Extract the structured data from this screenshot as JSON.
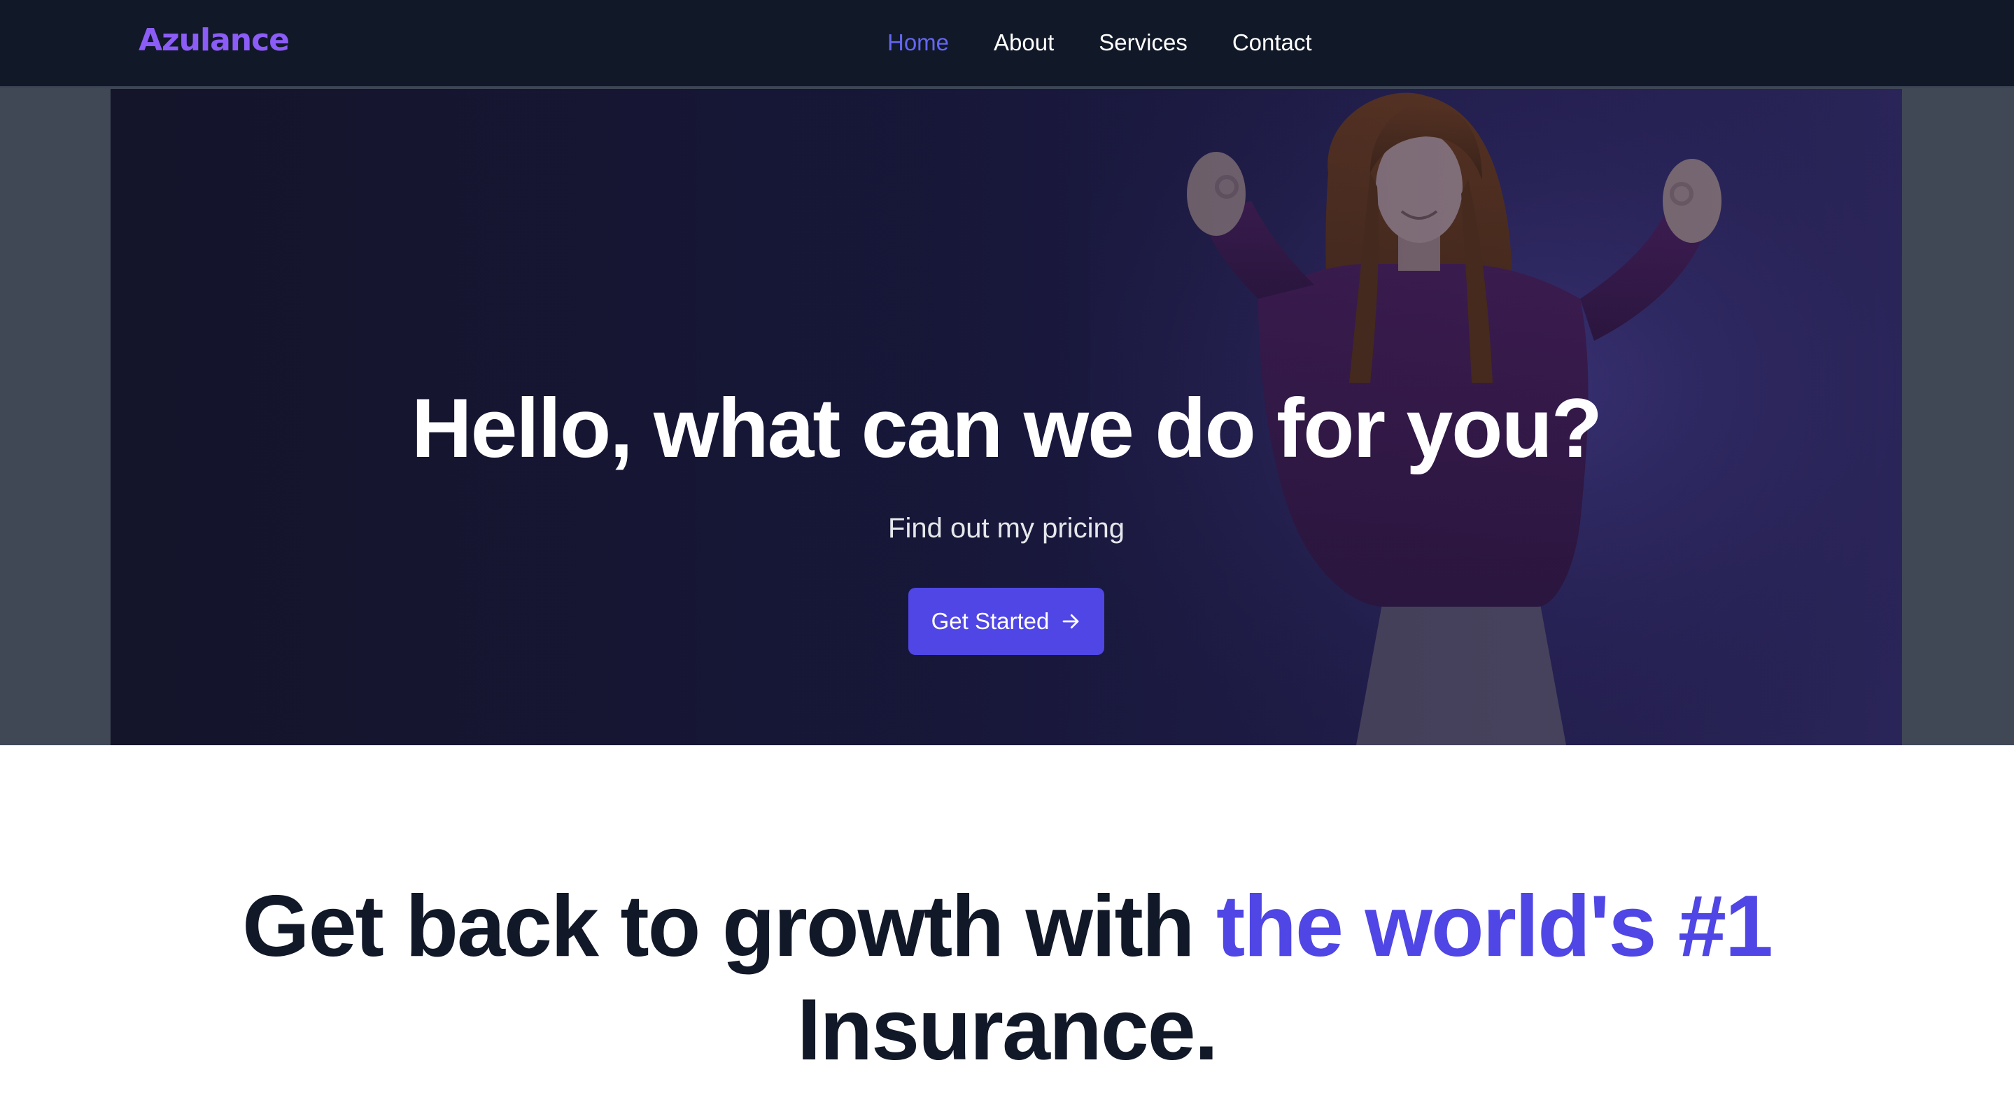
{
  "brand": {
    "name": "Azulance",
    "color": "#8b5cf6"
  },
  "nav": {
    "items": [
      {
        "label": "Home",
        "active": true
      },
      {
        "label": "About",
        "active": false
      },
      {
        "label": "Services",
        "active": false
      },
      {
        "label": "Contact",
        "active": false
      }
    ]
  },
  "hero": {
    "title": "Hello, what can we do for you?",
    "subtitle": "Find out my pricing",
    "cta_label": "Get Started",
    "cta_icon": "arrow-right-icon"
  },
  "growth": {
    "heading_part1": "Get back to growth with ",
    "heading_accent": "the world's #1",
    "heading_part2": "Insurance."
  },
  "colors": {
    "navbar_bg": "#111827",
    "accent": "#4f46e5",
    "active_nav": "#6366f1",
    "heading_text": "#111827"
  }
}
